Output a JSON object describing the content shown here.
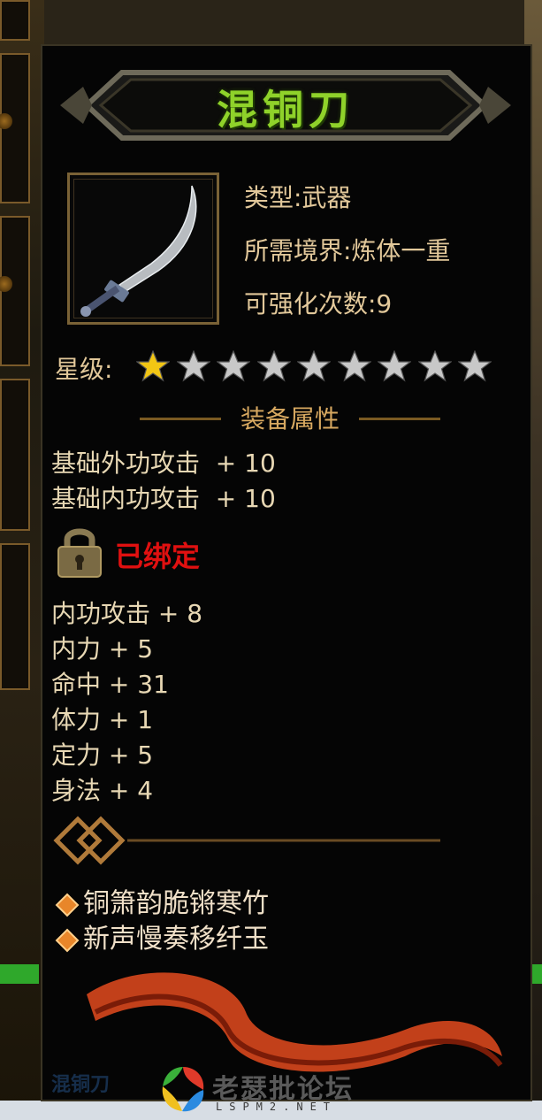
{
  "item": {
    "name": "混铜刀",
    "type_line": "类型:武器",
    "realm_line": "所需境界:炼体一重",
    "enhance_line": "可强化次数:9"
  },
  "stars": {
    "label": "星级:",
    "filled": 1,
    "total": 9,
    "filled_color": "#f2c614",
    "empty_color": "#c8c8c8"
  },
  "equip_section": {
    "title": "装备属性",
    "base_attrs": [
      "基础外功攻击  + 10",
      "基础内功攻击  + 10"
    ]
  },
  "binding": {
    "text": "已绑定",
    "color": "#e01010"
  },
  "bonus_attrs": [
    "内功攻击 + 8",
    "内力 + 5",
    "命中 + 31",
    "体力 + 1",
    "定力 + 5",
    "身法 + 4"
  ],
  "suit_lines": [
    "铜箫韵脆锵寒竹",
    "新声慢奏移纤玉"
  ],
  "watermark": {
    "ghost_text": "混铜刀",
    "site_name": "老瑟批论坛",
    "site_url": "LSPM2.NET"
  },
  "colors": {
    "title_green": "#8fd22a",
    "text_gold": "#e2c89a",
    "panel_bg": "#050505"
  }
}
